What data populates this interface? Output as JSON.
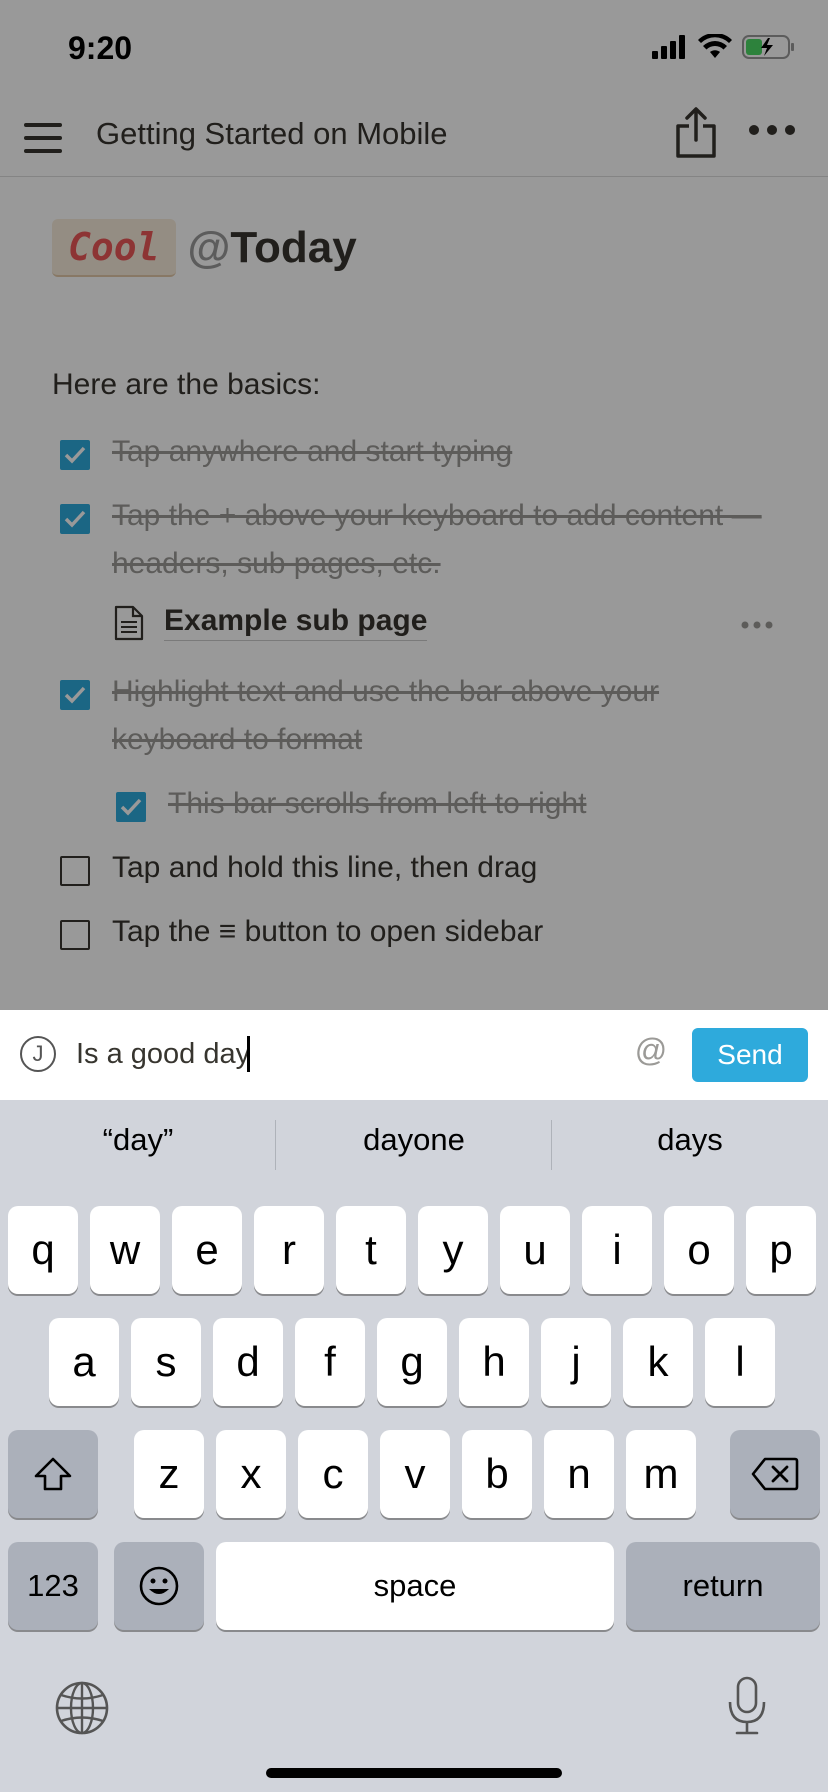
{
  "status_bar": {
    "time": "9:20"
  },
  "nav": {
    "title": "Getting Started on Mobile"
  },
  "page": {
    "title_chip": "Cool",
    "title_mention_at": "@",
    "title_mention": "Today",
    "intro": "Here are the basics:",
    "todos": [
      {
        "text": "Tap anywhere and start typing",
        "checked": true
      },
      {
        "text": "Tap the + above your keyboard to add content — headers, sub pages, etc.",
        "checked": true
      },
      {
        "text": "Highlight text and use the bar above your keyboard to format",
        "checked": true
      },
      {
        "text": "This bar scrolls from left to right",
        "checked": true
      },
      {
        "text": "Tap and hold this line, then drag",
        "checked": false
      },
      {
        "text_before": "Tap the",
        "text_icon": "≡",
        "text_after": "button to open sidebar",
        "checked": false
      }
    ],
    "subpage": {
      "label": "Example sub page"
    }
  },
  "comment": {
    "avatar_initial": "J",
    "input_value": "Is a good day",
    "at_label": "@",
    "send_label": "Send"
  },
  "keyboard": {
    "suggestions": [
      "“day”",
      "dayone",
      "days"
    ],
    "row1": [
      "q",
      "w",
      "e",
      "r",
      "t",
      "y",
      "u",
      "i",
      "o",
      "p"
    ],
    "row2": [
      "a",
      "s",
      "d",
      "f",
      "g",
      "h",
      "j",
      "k",
      "l"
    ],
    "row3": [
      "z",
      "x",
      "c",
      "v",
      "b",
      "n",
      "m"
    ],
    "numbers_label": "123",
    "space_label": "space",
    "return_label": "return"
  },
  "colors": {
    "accent": "#2eaadc",
    "chip_text": "#eb5757",
    "chip_bg": "#f7ecdb",
    "keyboard_bg": "#d1d4db"
  },
  "icons": [
    "menu-icon",
    "share-icon",
    "more-icon",
    "page-icon",
    "checkbox-check-icon",
    "shift-icon",
    "backspace-icon",
    "emoji-icon",
    "globe-icon",
    "microphone-icon",
    "signal-icon",
    "wifi-icon",
    "battery-icon"
  ]
}
